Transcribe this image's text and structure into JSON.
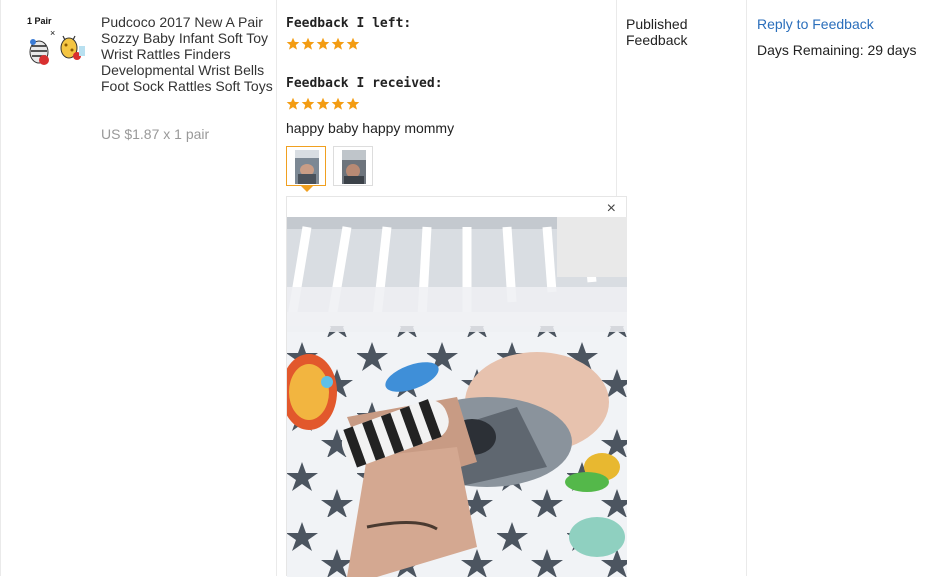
{
  "product": {
    "thumb_badge": "1 Pair",
    "thumb_cross": "×",
    "title": "Pudcoco 2017 New A Pair Sozzy Baby Infant Soft Toy Wrist Rattles Finders Developmental Wrist Bells Foot Sock Rattles Soft Toys",
    "price": "US $1.87 x 1 pair"
  },
  "feedback": {
    "left_label": "Feedback I left:",
    "left_rating": 5,
    "received_label": "Feedback I received:",
    "received_rating": 5,
    "received_text": "happy baby happy mommy",
    "photos": [
      {
        "name": "photo-thumb-1",
        "selected": true
      },
      {
        "name": "photo-thumb-2",
        "selected": false
      }
    ],
    "viewer_close": "×"
  },
  "status": {
    "label": "Published Feedback"
  },
  "actions": {
    "reply_label": "Reply to Feedback",
    "days_remaining": "Days Remaining: 29 days"
  },
  "colors": {
    "star": "#f39c12",
    "link": "#2a6ebb",
    "muted": "#999999",
    "divider": "#eaeaea"
  },
  "icons": [
    "star-icon",
    "close-icon"
  ]
}
